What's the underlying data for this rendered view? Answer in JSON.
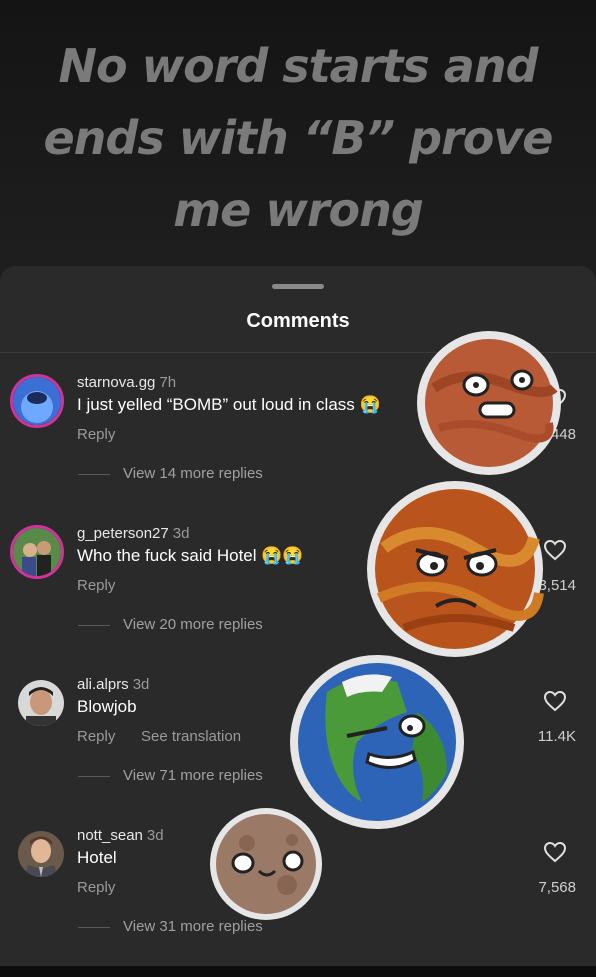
{
  "hero": {
    "title": "No word starts and ends with “B” prove me wrong"
  },
  "sheet": {
    "title": "Comments"
  },
  "comments": [
    {
      "username": "starnova.gg",
      "time": "7h",
      "text": "I just yelled “BOMB” out loud in class 😭",
      "reply": "Reply",
      "likes": "1,448",
      "more": "View 14 more replies"
    },
    {
      "username": "g_peterson27",
      "time": "3d",
      "text": "Who the fuck said Hotel 😭😭",
      "reply": "Reply",
      "likes": "3,514",
      "more": "View 20 more replies"
    },
    {
      "username": "ali.alprs",
      "time": "3d",
      "text": "Blowjob",
      "reply": "Reply",
      "translation": "See translation",
      "likes": "11.4K",
      "more": "View 71 more replies"
    },
    {
      "username": "nott_sean",
      "time": "3d",
      "text": "Hotel",
      "reply": "Reply",
      "likes": "7,568",
      "more": "View 31 more replies"
    }
  ],
  "colors": {
    "background": "#2a2a2a",
    "muted": "#9a9a9a",
    "ring": "#d0339a"
  }
}
